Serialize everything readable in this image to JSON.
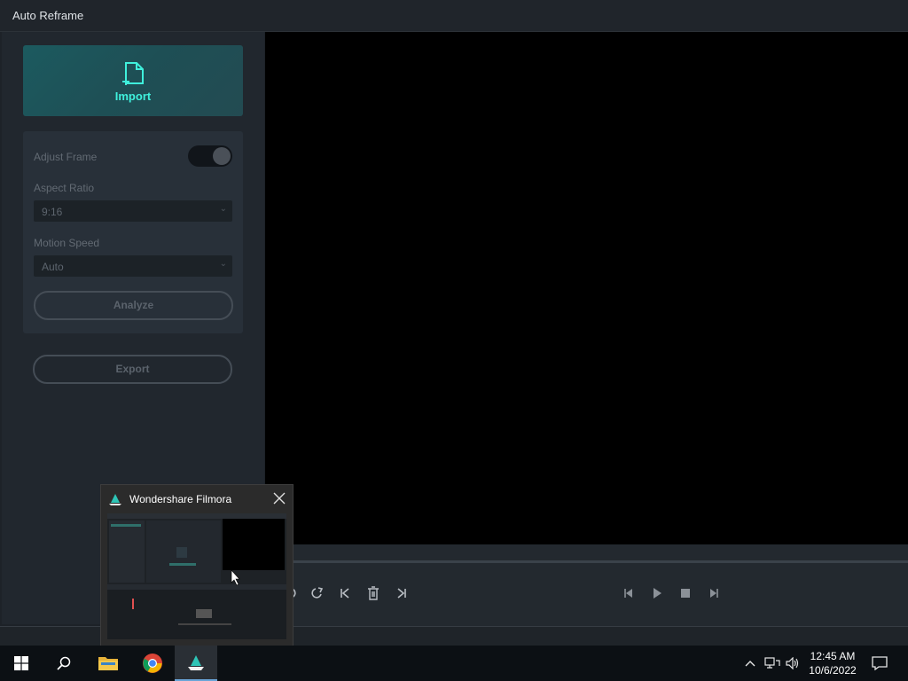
{
  "window": {
    "title": "Auto Reframe"
  },
  "import": {
    "label": "Import"
  },
  "settings": {
    "adjust_frame_label": "Adjust Frame",
    "aspect_ratio_label": "Aspect Ratio",
    "aspect_ratio_value": "9:16",
    "motion_speed_label": "Motion Speed",
    "motion_speed_value": "Auto",
    "analyze_label": "Analyze"
  },
  "export": {
    "label": "Export"
  },
  "thumbnail": {
    "title": "Wondershare Filmora"
  },
  "taskbar": {
    "time": "12:45 AM",
    "date": "10/6/2022"
  },
  "colors": {
    "accent": "#3ff0dc",
    "panel": "#21272e",
    "preview": "#000000",
    "taskbar": "#0c1014"
  },
  "icons": {
    "import": "import-file-icon",
    "undo": "undo-icon",
    "redo": "redo-icon",
    "skip_start": "skip-start-icon",
    "delete": "trash-icon",
    "skip_end": "skip-end-icon",
    "prev_frame": "prev-frame-icon",
    "play": "play-icon",
    "stop": "stop-icon",
    "next_frame": "next-frame-icon"
  }
}
